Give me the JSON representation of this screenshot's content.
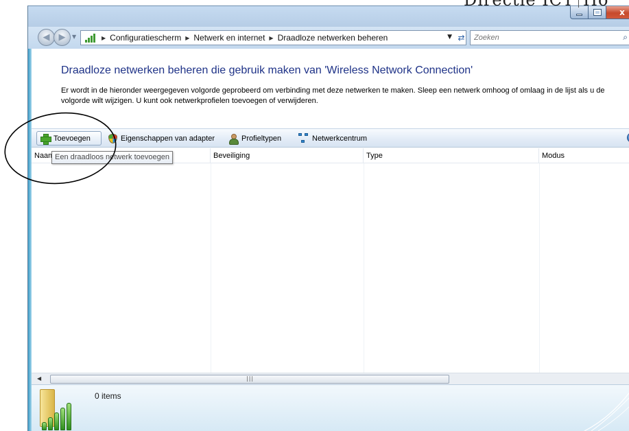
{
  "document_overlay": {
    "text_left": "Directie ICT",
    "text_right": "Ho"
  },
  "window": {
    "caption_buttons": {
      "minimize": "minimize",
      "maximize": "maximize",
      "close": "x"
    }
  },
  "nav": {
    "breadcrumb": [
      "Configuratiescherm",
      "Netwerk en internet",
      "Draadloze netwerken beheren"
    ],
    "search_placeholder": "Zoeken"
  },
  "page": {
    "title": "Draadloze netwerken beheren die gebruik maken van 'Wireless Network Connection'",
    "description": "Er wordt in de hieronder weergegeven volgorde geprobeerd om verbinding met deze netwerken te maken. Sleep een netwerk omhoog of omlaag in de lijst als u de volgorde wilt wijzigen. U kunt ook netwerkprofielen toevoegen of verwijderen."
  },
  "toolbar": {
    "add_label": "Toevoegen",
    "adapter_properties_label": "Eigenschappen van adapter",
    "profile_types_label": "Profieltypen",
    "network_center_label": "Netwerkcentrum",
    "help_label": "?"
  },
  "list": {
    "columns": [
      "Naam",
      "Beveiliging",
      "Type",
      "Modus"
    ],
    "rows": []
  },
  "tooltip": {
    "text": "Een draadloos netwerk toevoegen"
  },
  "details": {
    "items_count": "0 items"
  },
  "icons": {
    "back": "back-arrow-icon",
    "forward": "forward-arrow-icon",
    "network": "network-signal-icon",
    "refresh": "refresh-icon",
    "search": "search-icon",
    "add": "green-plus-icon",
    "adapter": "shield-icon",
    "profiles": "user-icon",
    "network_center": "network-center-icon",
    "help": "help-icon"
  },
  "colors": {
    "title": "#1e3287",
    "close_button": "#c64a2c",
    "toolbar": "#e3ecf7",
    "details_pane": "#d6e9f5",
    "signal_green": "#2f8e1e"
  }
}
